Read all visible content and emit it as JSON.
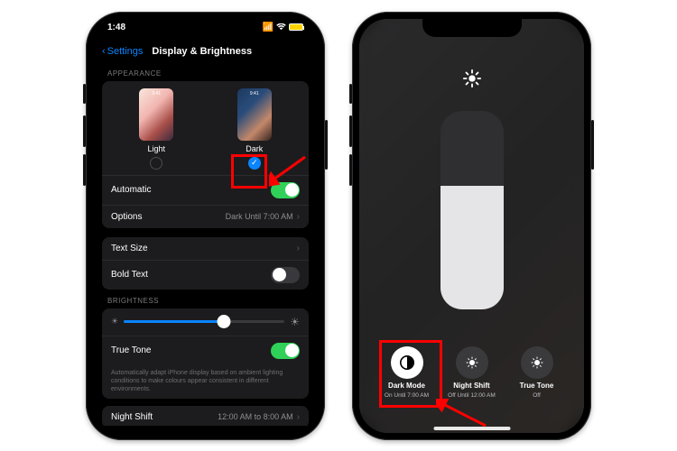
{
  "status": {
    "time": "1:48",
    "battery": "61"
  },
  "nav": {
    "back": "Settings",
    "title": "Display & Brightness"
  },
  "sections": {
    "appearance_label": "APPEARANCE",
    "light": "Light",
    "dark": "Dark",
    "automatic": "Automatic",
    "options": "Options",
    "options_value": "Dark Until 7:00 AM",
    "text_size": "Text Size",
    "bold_text": "Bold Text",
    "brightness_label": "BRIGHTNESS",
    "true_tone": "True Tone",
    "true_tone_foot": "Automatically adapt iPhone display based on ambient lighting conditions to make colours appear consistent in different environments.",
    "night_shift": "Night Shift",
    "night_shift_value": "12:00 AM to 8:00 AM"
  },
  "cc": {
    "dark_mode": "Dark Mode",
    "dark_mode_sub": "On Until 7:00 AM",
    "night_shift": "Night Shift",
    "night_shift_sub": "Off Until 12:00 AM",
    "true_tone": "True Tone",
    "true_tone_sub": "Off"
  }
}
